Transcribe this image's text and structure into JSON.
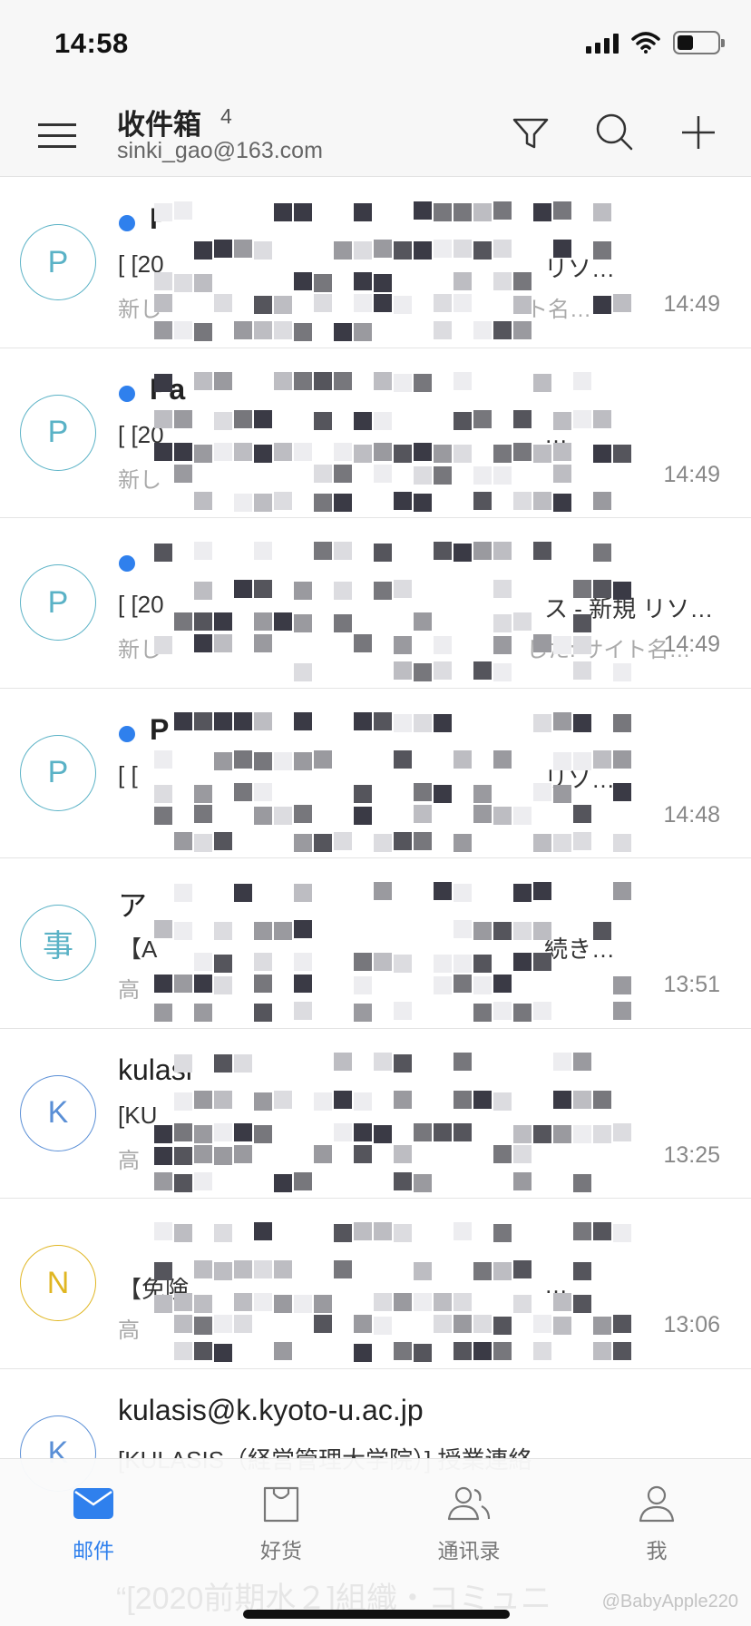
{
  "status_bar": {
    "time": "14:58",
    "battery_level": 0.4
  },
  "header": {
    "title": "收件箱",
    "unread_count": "4",
    "account_email": "sinki_gao@163.com",
    "icons": [
      "filter-icon",
      "search-icon",
      "plus-icon",
      "menu-icon"
    ]
  },
  "mails": [
    {
      "avatar": "P",
      "avatar_color": "#5ab2c6",
      "unread": true,
      "sender": "P",
      "subject": "[ [20",
      "subject_end": "リソ…",
      "preview": "新し",
      "preview_end": "ト名…",
      "time": "14:49"
    },
    {
      "avatar": "P",
      "avatar_color": "#5ab2c6",
      "unread": true,
      "sender": "Pa",
      "subject": "[ [20",
      "subject_end": "…",
      "preview": "新し",
      "preview_end": "",
      "time": "14:49"
    },
    {
      "avatar": "P",
      "avatar_color": "#5ab2c6",
      "unread": true,
      "sender": "",
      "subject": "[ [20",
      "subject_end": "ス - 新規 リソ…",
      "preview": "新し",
      "preview_end": "した: サイト名…",
      "time": "14:49"
    },
    {
      "avatar": "P",
      "avatar_color": "#5ab2c6",
      "unread": true,
      "sender": "P",
      "subject": "[ [",
      "subject_end": "リソ…",
      "preview": "",
      "preview_end": "",
      "time": "14:48"
    },
    {
      "avatar": "事",
      "avatar_color": "#5ab2c6",
      "unread": false,
      "sender": "ア",
      "subject": "【A",
      "subject_end": "続き…",
      "preview": "高",
      "preview_end": "",
      "time": "13:51"
    },
    {
      "avatar": "K",
      "avatar_color": "#5a8fd6",
      "unread": false,
      "sender": "kulasi",
      "subject": "[KU",
      "subject_end": "",
      "preview": "高",
      "preview_end": "",
      "time": "13:25"
    },
    {
      "avatar": "N",
      "avatar_color": "#e0b622",
      "unread": false,
      "sender": "",
      "subject": "【免険",
      "subject_end": "…",
      "preview": "高",
      "preview_end": "",
      "time": "13:06"
    },
    {
      "avatar": "K",
      "avatar_color": "#5a8fd6",
      "unread": false,
      "sender": "kulasis@k.kyoto-u.ac.jp",
      "subject": "[KULASIS（経営管理大学院）] 授業連絡",
      "subject_end": "",
      "preview": "",
      "preview_end": "",
      "time": ""
    }
  ],
  "tabs": [
    {
      "label": "邮件",
      "icon": "mail-icon",
      "active": true
    },
    {
      "label": "好货",
      "icon": "shopping-bag-icon",
      "active": false
    },
    {
      "label": "通讯录",
      "icon": "contacts-icon",
      "active": false
    },
    {
      "label": "我",
      "icon": "profile-icon",
      "active": false
    }
  ],
  "footer": {
    "ghost_text": "“[2020前期水２]組織・コミュニ",
    "watermark": "@BabyApple220"
  },
  "colors": {
    "accent": "#2f80ed",
    "unread_dot": "#2f80ed",
    "background": "#ffffff",
    "header_bg": "#f7f7f7"
  }
}
